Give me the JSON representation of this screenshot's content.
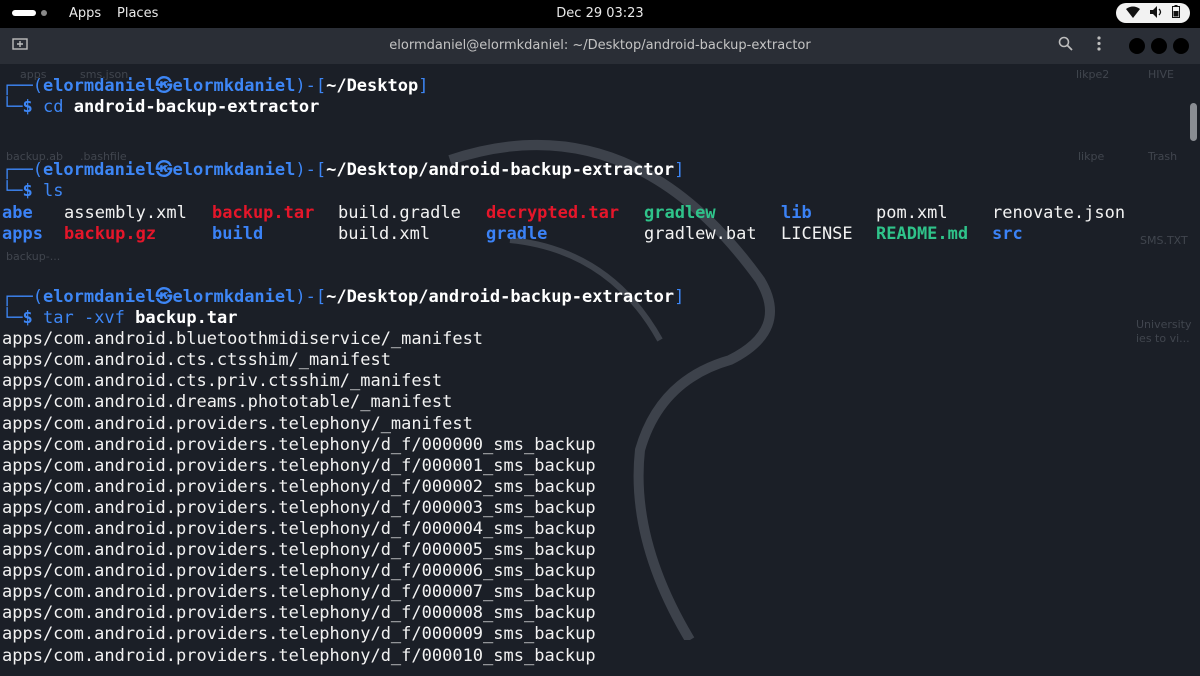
{
  "topbar": {
    "apps_label": "Apps",
    "places_label": "Places",
    "clock": "Dec 29  03:23",
    "tray_icons": [
      "wifi-icon",
      "volume-icon",
      "battery-icon"
    ]
  },
  "window": {
    "title": "elormdaniel@elormkdaniel: ~/Desktop/android-backup-extractor"
  },
  "desktop_icons": [
    "apps",
    "sms.json",
    "backup.ab",
    ".bashfile",
    "backup-...",
    "likpe2",
    "HIVE",
    "likpe",
    "Trash",
    "SMS.TXT",
    "University",
    "ies to vi..."
  ],
  "terminal": {
    "prompt": {
      "open": "┌──(",
      "user": "elormdaniel",
      "at": "㉿",
      "host": "elormkdaniel",
      "mid": ")-[",
      "close": "]",
      "corner": "└─",
      "dollar": "$"
    },
    "blocks": [
      {
        "path": "~/Desktop",
        "command": "cd",
        "args": "android-backup-extractor"
      },
      {
        "path": "~/Desktop/android-backup-extractor",
        "command": "ls",
        "args": ""
      },
      {
        "path": "~/Desktop/android-backup-extractor",
        "command": "tar",
        "flags": "-xvf",
        "args": "backup.tar"
      }
    ],
    "ls_rows": [
      [
        "abe",
        "assembly.xml",
        "backup.tar",
        "build.gradle",
        "decrypted.tar",
        "gradlew",
        "lib",
        "pom.xml",
        "renovate.json"
      ],
      [
        "apps",
        "backup.gz",
        "build",
        "build.xml",
        "gradle",
        "gradlew.bat",
        "LICENSE",
        "README.md",
        "src"
      ]
    ],
    "tar_output": [
      "apps/com.android.bluetoothmidiservice/_manifest",
      "apps/com.android.cts.ctsshim/_manifest",
      "apps/com.android.cts.priv.ctsshim/_manifest",
      "apps/com.android.dreams.phototable/_manifest",
      "apps/com.android.providers.telephony/_manifest",
      "apps/com.android.providers.telephony/d_f/000000_sms_backup",
      "apps/com.android.providers.telephony/d_f/000001_sms_backup",
      "apps/com.android.providers.telephony/d_f/000002_sms_backup",
      "apps/com.android.providers.telephony/d_f/000003_sms_backup",
      "apps/com.android.providers.telephony/d_f/000004_sms_backup",
      "apps/com.android.providers.telephony/d_f/000005_sms_backup",
      "apps/com.android.providers.telephony/d_f/000006_sms_backup",
      "apps/com.android.providers.telephony/d_f/000007_sms_backup",
      "apps/com.android.providers.telephony/d_f/000008_sms_backup",
      "apps/com.android.providers.telephony/d_f/000009_sms_backup",
      "apps/com.android.providers.telephony/d_f/000010_sms_backup"
    ],
    "colors": {
      "prompt": "#3d86f5",
      "directory": "#3b82f6",
      "archive": "#e5162a",
      "executable": "#2fc38a",
      "text": "#f2f2f2",
      "background": "#1b1f27"
    }
  }
}
